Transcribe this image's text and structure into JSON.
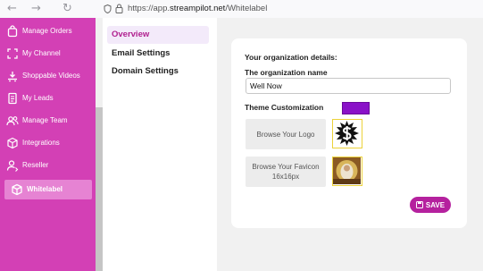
{
  "browser": {
    "back_glyph": "←",
    "forward_glyph": "→",
    "refresh_glyph": "↻",
    "url_scheme": "https://app.",
    "url_domain": "streampilot.net",
    "url_path": "/Whitelabel"
  },
  "sidebar": {
    "items": [
      {
        "label": "Manage Orders",
        "icon": "bag-icon"
      },
      {
        "label": "My Channel",
        "icon": "channel-frame-icon"
      },
      {
        "label": "Shoppable Videos",
        "icon": "video-cart-icon"
      },
      {
        "label": "My Leads",
        "icon": "leads-document-icon"
      },
      {
        "label": "Manage Team",
        "icon": "team-icon"
      },
      {
        "label": "Integrations",
        "icon": "cube-icon"
      },
      {
        "label": "Reseller",
        "icon": "reseller-user-icon"
      },
      {
        "label": "Whitelabel",
        "icon": "whitelabel-cube-icon",
        "active": true
      }
    ]
  },
  "subnav": {
    "items": [
      "Overview",
      "Email Settings",
      "Domain Settings"
    ],
    "active": "Overview"
  },
  "form": {
    "section_title": "Your organization details:",
    "org_name_label": "The organization name",
    "org_name_value": "Well Now",
    "theme_label": "Theme Customization",
    "theme_color": "#8a12c8",
    "browse_logo": "Browse Your Logo",
    "browse_favicon_line1": "Browse Your Favicon",
    "browse_favicon_line2": "16x16px",
    "save_label": "SAVE"
  },
  "colors": {
    "sidebar_bg": "#d340b5",
    "accent": "#b5219e",
    "active_sidebar": "#e683d3"
  }
}
